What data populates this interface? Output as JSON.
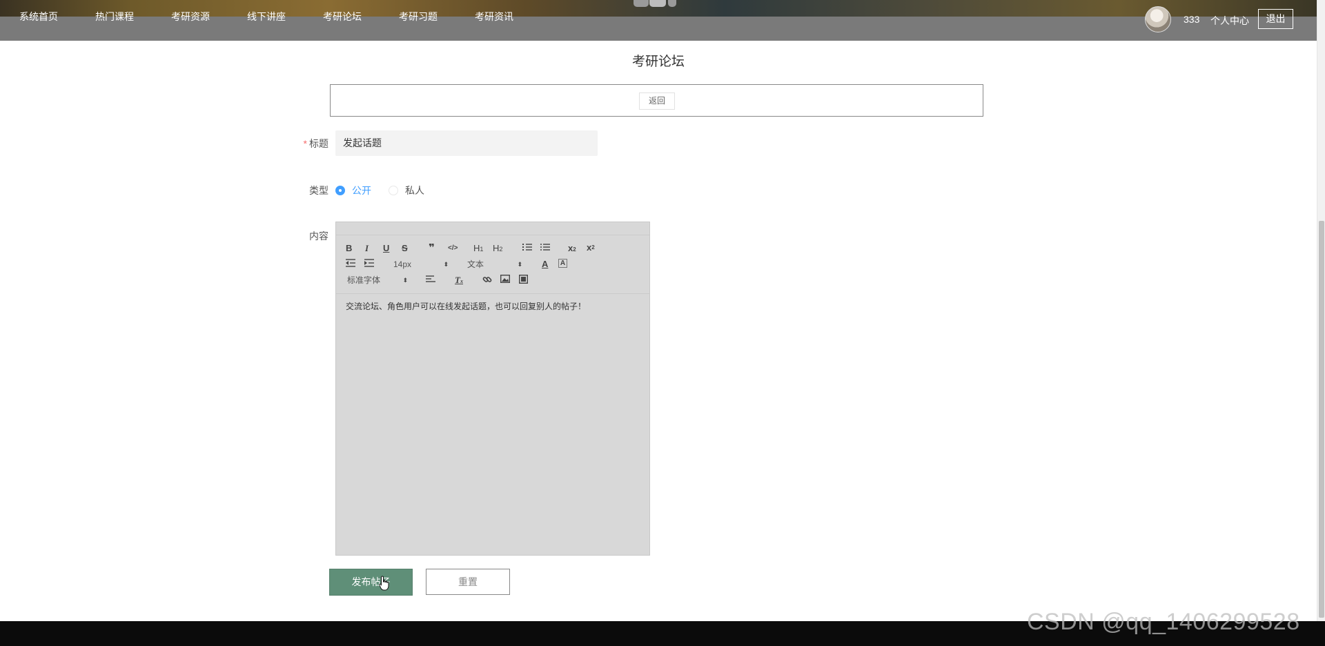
{
  "nav": {
    "items": [
      {
        "label": "系统首页"
      },
      {
        "label": "热门课程"
      },
      {
        "label": "考研资源"
      },
      {
        "label": "线下讲座"
      },
      {
        "label": "考研论坛"
      },
      {
        "label": "考研习题"
      },
      {
        "label": "考研资讯"
      }
    ],
    "user_name": "333",
    "user_center": "个人中心",
    "logout": "退出"
  },
  "page": {
    "title": "考研论坛",
    "back_label": "返回"
  },
  "form": {
    "title_label": "标题",
    "title_required_mark": "*",
    "title_value": "发起话题",
    "type_label": "类型",
    "type_options": [
      {
        "label": "公开",
        "selected": true
      },
      {
        "label": "私人",
        "selected": false
      }
    ],
    "content_label": "内容",
    "editor": {
      "font_size": "14px",
      "paragraph": "文本",
      "font_family": "标准字体",
      "content": "交流论坛、角色用户可以在线发起话题，也可以回复别人的帖子！",
      "toolbar_icons": [
        "bold-icon",
        "italic-icon",
        "underline-icon",
        "strikethrough-icon",
        "blockquote-icon",
        "code-block-icon",
        "h1-icon",
        "h2-icon",
        "ordered-list-icon",
        "bullet-list-icon",
        "subscript-icon",
        "superscript-icon",
        "outdent-icon",
        "indent-icon",
        "font-color-icon",
        "background-color-icon",
        "align-icon",
        "clear-format-icon",
        "link-icon",
        "image-icon",
        "video-icon"
      ]
    },
    "submit_label": "发布帖子",
    "reset_label": "重置"
  },
  "watermark": "CSDN @qq_1406299528",
  "colors": {
    "nav_bg": "#7a7a7a",
    "accent": "#409eff",
    "submit_bg": "#5f8f78",
    "editor_bg": "#d8d8d8"
  }
}
